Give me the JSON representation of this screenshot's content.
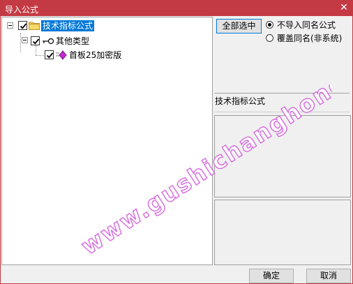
{
  "window": {
    "title": "导入公式",
    "close_glyph": "✕"
  },
  "tree": {
    "nodes": [
      {
        "label": "技术指标公式",
        "checked": true,
        "icon": "folder-icon",
        "selected": true
      },
      {
        "label": "其他类型",
        "checked": true,
        "icon": "key-icon"
      },
      {
        "label": "首板25加密版",
        "checked": true,
        "icon": "diamond-formula-icon"
      }
    ]
  },
  "options": {
    "select_all_label": "全部选中",
    "radio_skip_label": "不导入同名公式",
    "radio_overwrite_label": "覆盖同名(非系统)",
    "selected_option": "skip"
  },
  "description": {
    "header": "技术指标公式"
  },
  "buttons": {
    "ok_label": "确定",
    "cancel_label": "取消"
  },
  "watermark": {
    "text": "www.gushichanghong.com"
  },
  "colors": {
    "titlebar": "#c43a44",
    "selection": "#0078d7",
    "folder": "#f2c94c",
    "diamond": "#c12ad0",
    "watermark": "#d56bde"
  }
}
